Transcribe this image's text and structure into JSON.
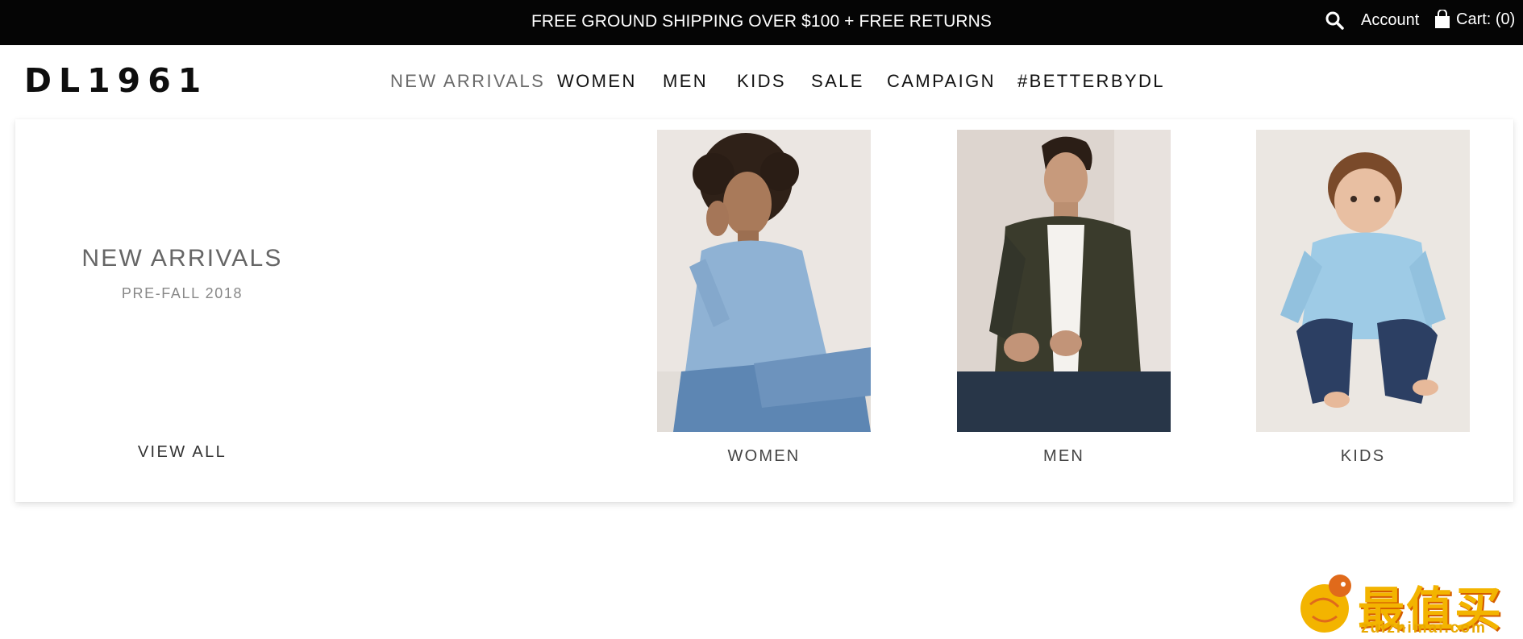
{
  "promo_bar": {
    "text": "FREE GROUND SHIPPING OVER $100 + FREE RETURNS",
    "account_label": "Account",
    "cart_label": "Cart: (0)",
    "icons": [
      "search-icon",
      "shopping-bag-icon"
    ]
  },
  "header": {
    "logo": "DL1961",
    "nav": [
      {
        "label": "NEW ARRIVALS",
        "active": true
      },
      {
        "label": "WOMEN"
      },
      {
        "label": "MEN"
      },
      {
        "label": "KIDS"
      },
      {
        "label": "SALE"
      },
      {
        "label": "CAMPAIGN"
      },
      {
        "label": "#BETTERBYDL"
      }
    ]
  },
  "mega_menu": {
    "title": "NEW ARRIVALS",
    "subtitle": "PRE-FALL 2018",
    "view_all": "VIEW ALL",
    "categories": [
      {
        "label": "WOMEN"
      },
      {
        "label": "MEN"
      },
      {
        "label": "KIDS"
      }
    ]
  },
  "watermark": {
    "text": "最值买",
    "sub": "zuizhimai.com"
  },
  "colors": {
    "topbar_bg": "#050505",
    "nav_active": "#6a6a6a",
    "watermark": "#f3b400"
  }
}
